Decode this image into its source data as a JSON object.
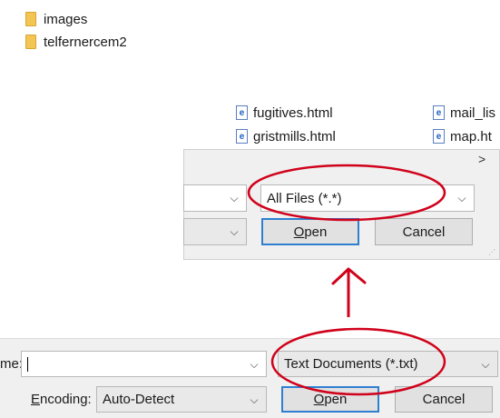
{
  "folders": [
    {
      "name": "images"
    },
    {
      "name": "telfernercem2"
    }
  ],
  "files": [
    {
      "name": "fugitives.html",
      "icon": "ie-html-file-icon"
    },
    {
      "name": "mail_lis",
      "icon": "ie-html-file-icon"
    },
    {
      "name": "gristmills.html",
      "icon": "ie-html-file-icon"
    },
    {
      "name": "map.ht",
      "icon": "ie-html-file-icon"
    }
  ],
  "top_dialog": {
    "scroll_right_glyph": ">",
    "filename_value": "",
    "filter_value": "All Files  (*.*)",
    "encoding_value": "",
    "open_label": "Open",
    "open_mnemonic": "O",
    "open_rest": "pen",
    "cancel_label": "Cancel"
  },
  "bottom_dialog": {
    "filename_label_partial": "me:",
    "filename_value": "",
    "filter_value": "Text Documents (*.txt)",
    "encoding_label": "Encoding:",
    "encoding_mnemonic": "E",
    "encoding_rest": "ncoding:",
    "encoding_value": "Auto-Detect",
    "open_label": "Open",
    "open_mnemonic": "O",
    "open_rest": "pen",
    "cancel_label": "Cancel"
  },
  "annotations": {
    "color": "#d0021b"
  },
  "colors": {
    "folder": "#f3c552",
    "accent_border": "#2f7fd1",
    "dialog_bg": "#f0f0f0"
  }
}
